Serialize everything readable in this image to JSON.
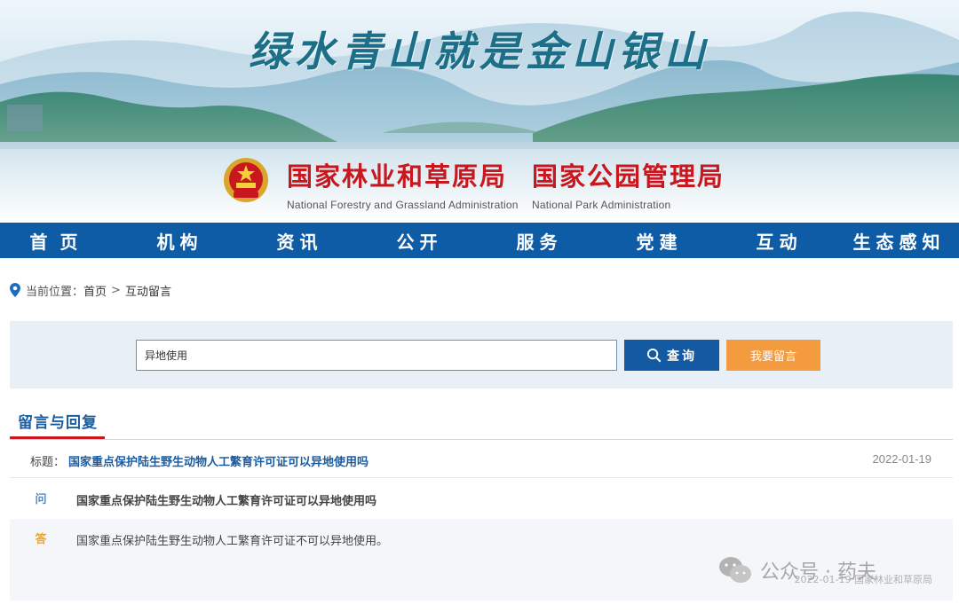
{
  "banner": {
    "slogan": "绿水青山就是金山银山",
    "org1_cn": "国家林业和草原局",
    "org1_en": "National Forestry and Grassland Administration",
    "org2_cn": "国家公园管理局",
    "org2_en": "National Park Administration"
  },
  "nav": {
    "items": [
      "首页",
      "机构",
      "资讯",
      "公开",
      "服务",
      "党建",
      "互动",
      "生态感知"
    ]
  },
  "breadcrumb": {
    "prefix": "当前位置：",
    "home": "首页",
    "separator": ">",
    "current": "互动留言"
  },
  "search": {
    "value": "异地使用",
    "button_label": "查询",
    "message_button_label": "我要留言"
  },
  "section": {
    "title": "留言与回复"
  },
  "entry": {
    "title_prefix": "标题：",
    "title": "国家重点保护陆生野生动物人工繁育许可证可以异地使用吗",
    "date": "2022-01-19",
    "question_mark": "问",
    "question": "国家重点保护陆生野生动物人工繁育许可证可以异地使用吗",
    "answer_mark": "答",
    "answer": "国家重点保护陆生野生动物人工繁育许可证不可以异地使用。",
    "answer_footer": "2022-01-19 国家林业和草原局"
  },
  "watermark": {
    "text": "公众号 · 药夫"
  },
  "colors": {
    "nav_bg": "#0f5ca6",
    "org_red": "#c8171e",
    "search_btn": "#135aa3",
    "message_btn": "#f59b3f",
    "section_title": "#1a5c9f"
  }
}
